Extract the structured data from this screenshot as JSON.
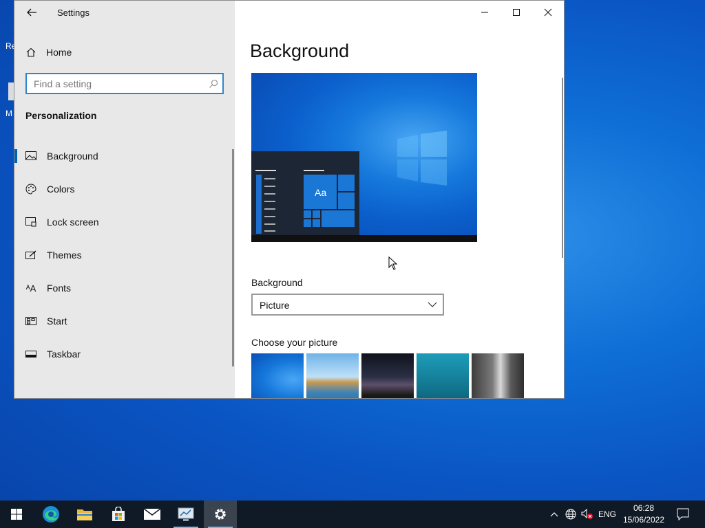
{
  "window": {
    "title": "Settings",
    "home_label": "Home",
    "search_placeholder": "Find a setting",
    "section_title": "Personalization",
    "nav": [
      {
        "label": "Background",
        "icon": "picture-icon",
        "active": true
      },
      {
        "label": "Colors",
        "icon": "palette-icon"
      },
      {
        "label": "Lock screen",
        "icon": "lock-screen-icon"
      },
      {
        "label": "Themes",
        "icon": "themes-icon"
      },
      {
        "label": "Fonts",
        "icon": "fonts-icon"
      },
      {
        "label": "Start",
        "icon": "start-icon"
      },
      {
        "label": "Taskbar",
        "icon": "taskbar-icon"
      }
    ]
  },
  "content": {
    "page_title": "Background",
    "preview_tile_text": "Aa",
    "background_label": "Background",
    "background_value": "Picture",
    "choose_label": "Choose your picture"
  },
  "taskbar": {
    "language": "ENG",
    "time": "06:28",
    "date": "15/06/2022"
  },
  "desktop": {
    "frag1": "Re",
    "frag2": "M"
  },
  "colors": {
    "accent": "#0063b1",
    "focus_border": "#2b86d1",
    "sidebar_bg": "#e8e8e8",
    "taskbar_bg": "#101a26"
  }
}
